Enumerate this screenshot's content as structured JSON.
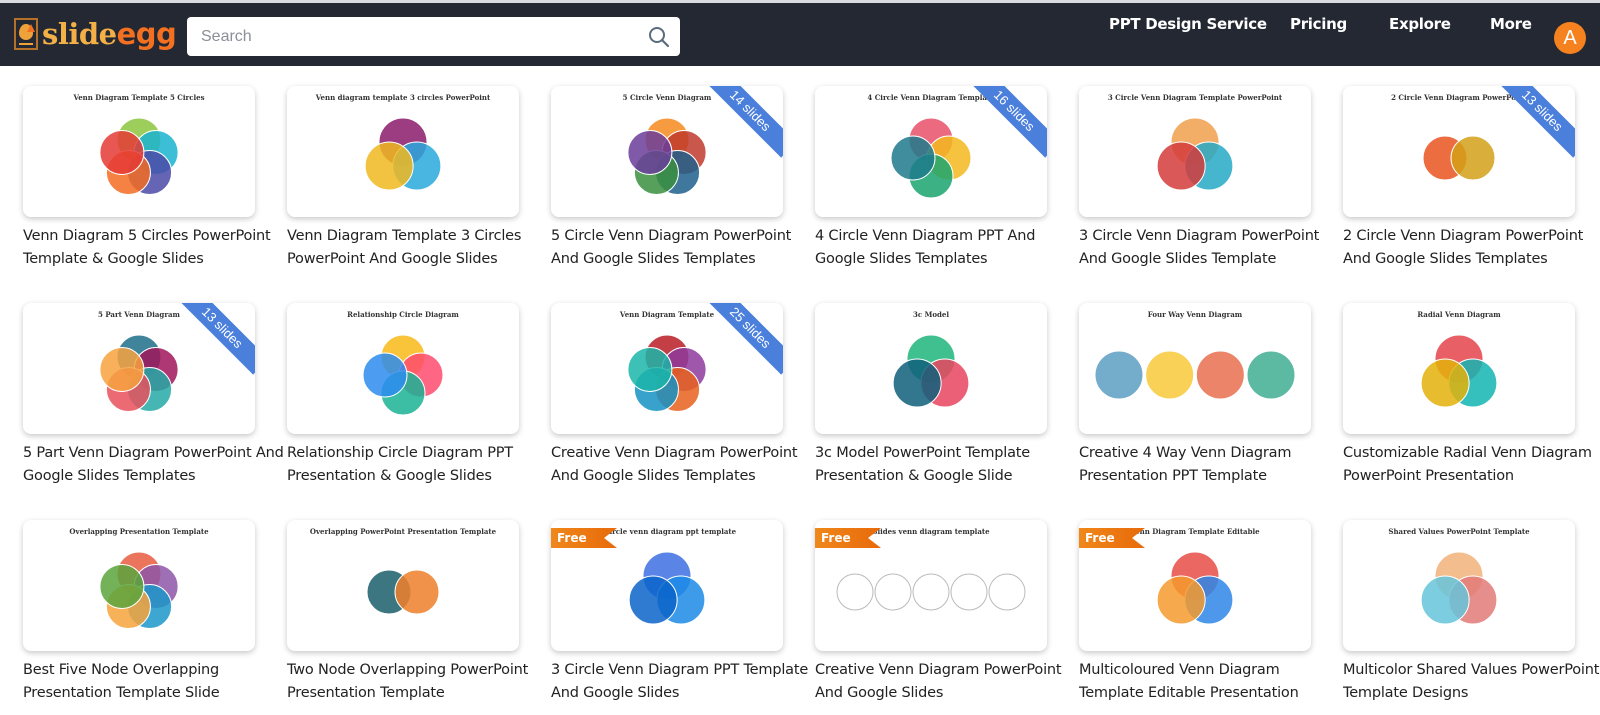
{
  "header": {
    "logo": {
      "part1": "slide",
      "part2": "egg"
    },
    "search": {
      "placeholder": "Search",
      "value": "",
      "icon": "search-icon"
    },
    "nav": [
      {
        "label": "PPT Design Service"
      },
      {
        "label": "Pricing"
      },
      {
        "label": "Explore"
      },
      {
        "label": "More"
      }
    ],
    "avatar_initial": "A",
    "colors": {
      "bar": "#232833",
      "accent": "#f37021",
      "avatar": "#f5821f"
    }
  },
  "templates": [
    {
      "title": "Venn Diagram 5 Circles PowerPoint Template & Google Slides",
      "thumb_title": "Venn Diagram Template 5 Circles",
      "badge": null
    },
    {
      "title": "Venn Diagram Template 3 Circles PowerPoint And Google Slides",
      "thumb_title": "Venn diagram template 3 circles PowerPoint",
      "badge": null
    },
    {
      "title": "5 Circle Venn Diagram PowerPoint And Google Slides Templates",
      "thumb_title": "5 Circle Venn Diagram",
      "badge": "14 slides"
    },
    {
      "title": "4 Circle Venn Diagram PPT And Google Slides Templates",
      "thumb_title": "4 Circle Venn Diagram Template",
      "badge": "16 slides"
    },
    {
      "title": "3 Circle Venn Diagram PowerPoint And Google Slides Template",
      "thumb_title": "3 Circle Venn Diagram Template PowerPoint",
      "badge": null
    },
    {
      "title": "2 Circle Venn Diagram PowerPoint And Google Slides Templates",
      "thumb_title": "2 Circle Venn Diagram PowerPoint",
      "badge": "13 slides"
    },
    {
      "title": "5 Part Venn Diagram PowerPoint And Google Slides Templates",
      "thumb_title": "5 Part Venn Diagram",
      "badge": "13 slides"
    },
    {
      "title": "Relationship Circle Diagram PPT Presentation & Google Slides",
      "thumb_title": "Relationship Circle Diagram",
      "badge": null
    },
    {
      "title": "Creative Venn Diagram PowerPoint And Google Slides Templates",
      "thumb_title": "Venn Diagram Template",
      "badge": "25 slides"
    },
    {
      "title": "3c Model PowerPoint Template Presentation & Google Slide",
      "thumb_title": "3c Model",
      "badge": null
    },
    {
      "title": "Creative 4 Way Venn Diagram Presentation PPT Template",
      "thumb_title": "Four Way Venn Diagram",
      "badge": null
    },
    {
      "title": "Customizable Radial Venn Diagram PowerPoint Presentation",
      "thumb_title": "Radial Venn Diagram",
      "badge": null
    },
    {
      "title": "Best Five Node Overlapping Presentation Template Slide",
      "thumb_title": "Overlapping Presentation Template",
      "badge": null
    },
    {
      "title": "Two Node Overlapping PowerPoint Presentation Template",
      "thumb_title": "Overlapping PowerPoint Presentation Template",
      "badge": null
    },
    {
      "title": "3 Circle Venn Diagram PPT Template And Google Slides",
      "thumb_title": "3 circle venn diagram ppt template",
      "badge": "Free"
    },
    {
      "title": "Creative Venn Diagram PowerPoint And Google Slides",
      "thumb_title": "Slides venn diagram template",
      "badge": "Free"
    },
    {
      "title": "Multicoloured Venn Diagram Template Editable Presentation",
      "thumb_title": "Venn Diagram Template Editable",
      "badge": "Free"
    },
    {
      "title": "Multicolor Shared Values PowerPoint Template Designs",
      "thumb_title": "Shared Values PowerPoint Template",
      "badge": null
    }
  ],
  "thumb_palettes": [
    [
      "#8cc63f",
      "#1bb3d0",
      "#4b4aa8",
      "#f36b21",
      "#e53935"
    ],
    [
      "#8b1a6b",
      "#29a8dc",
      "#f0b91e"
    ],
    [
      "#f58a1f",
      "#c0392b",
      "#1f5f8b",
      "#3a8f3f",
      "#6a3d9a"
    ],
    [
      "#e8506a",
      "#f5b91e",
      "#1aa56e",
      "#1f7a8c"
    ],
    [
      "#f0a04b",
      "#26a9c6",
      "#d33b3b"
    ],
    [
      "#e8541e",
      "#d4a017"
    ],
    [
      "#1f6f8b",
      "#a0155b",
      "#25a9a6",
      "#e8505b",
      "#f7a23e"
    ],
    [
      "#f8b918",
      "#ff4b6e",
      "#19b394",
      "#2d8cf0"
    ],
    [
      "#b81d24",
      "#8e3a9d",
      "#e8621d",
      "#1590c3",
      "#1bb5a8"
    ],
    [
      "#1db57a",
      "#e9445f",
      "#0f5f7b"
    ],
    [
      "#5c9dc2",
      "#f8c93a",
      "#e86e4d",
      "#3fae93"
    ],
    [
      "#e4434a",
      "#13b5b1",
      "#e3b20b"
    ],
    [
      "#e85c41",
      "#8d56a7",
      "#1b96c9",
      "#f6a33b",
      "#5aa53c"
    ],
    [
      "#1a5f6b",
      "#ef7f2c"
    ],
    [
      "#3e6fe3",
      "#1b8ae6",
      "#0b64c9"
    ],
    [
      "#cfcfcf",
      "#cfcfcf",
      "#cfcfcf",
      "#cfcfcf",
      "#cfcfcf"
    ],
    [
      "#e84c45",
      "#2e86e6",
      "#f59a2e"
    ],
    [
      "#f2b27a",
      "#e07a78",
      "#66c4dc"
    ]
  ]
}
